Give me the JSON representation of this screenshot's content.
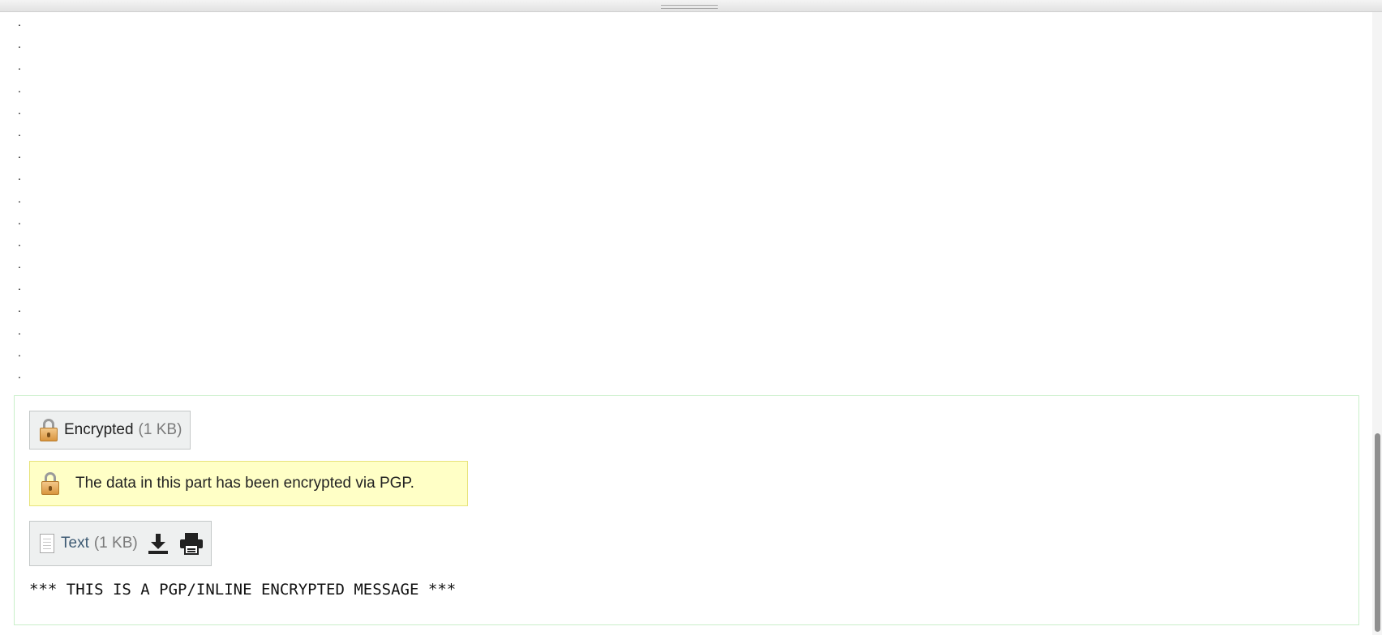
{
  "dots": [
    ".",
    ".",
    ".",
    ".",
    ".",
    ".",
    ".",
    ".",
    ".",
    ".",
    ".",
    ".",
    ".",
    ".",
    ".",
    ".",
    "."
  ],
  "encrypted_attachment": {
    "label": "Encrypted",
    "size": "(1 KB)",
    "icon": "lock-icon"
  },
  "notice": {
    "text": "The data in this part has been encrypted via PGP.",
    "icon": "lock-icon"
  },
  "text_attachment": {
    "label": "Text",
    "size": "(1 KB)",
    "icon": "text-document-icon",
    "actions": [
      "download-icon",
      "print-icon"
    ]
  },
  "message_body": "*** THIS IS A PGP/INLINE ENCRYPTED MESSAGE ***",
  "colors": {
    "notice_background": "#ffffc6",
    "part_border": "#c9efc9",
    "chip_background": "#eef0f0"
  }
}
